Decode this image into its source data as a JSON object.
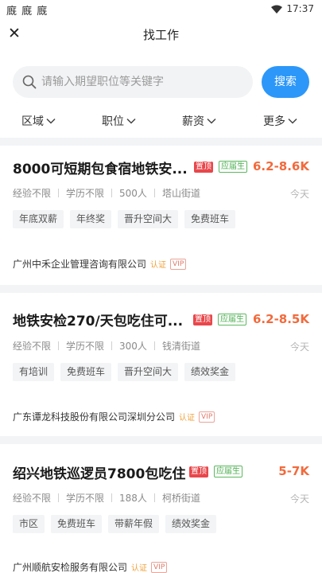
{
  "status_bar": {
    "left_icons": "廐 廐 廐",
    "time": "17:37"
  },
  "header": {
    "close_glyph": "✕",
    "title": "找工作"
  },
  "search": {
    "placeholder": "请输入期望职位等关键字",
    "button_label": "搜索"
  },
  "filters": [
    {
      "label": "区域"
    },
    {
      "label": "职位"
    },
    {
      "label": "薪资"
    },
    {
      "label": "更多"
    }
  ],
  "jobs": [
    {
      "title": "8000可短期包食宿地铁安...",
      "badge_top": "置顶",
      "badge_grad": "应届生",
      "salary": "6.2-8.6K",
      "meta": [
        "经验不限",
        "学历不限",
        "500人",
        "塔山街道"
      ],
      "date": "今天",
      "tags": [
        "年底双薪",
        "年终奖",
        "晋升空间大",
        "免费班车"
      ],
      "company": "广州中禾企业管理咨询有限公司",
      "cert": "认证",
      "vip": "VIP"
    },
    {
      "title": "地铁安检270/天包吃住可...",
      "badge_top": "置顶",
      "badge_grad": "应届生",
      "salary": "6.2-8.5K",
      "meta": [
        "经验不限",
        "学历不限",
        "300人",
        "钱清街道"
      ],
      "date": "今天",
      "tags": [
        "有培训",
        "免费班车",
        "晋升空间大",
        "绩效奖金"
      ],
      "company": "广东谭龙科技股份有限公司深圳分公司",
      "cert": "认证",
      "vip": "VIP"
    },
    {
      "title": "绍兴地铁巡逻员7800包吃住",
      "badge_top": "置顶",
      "badge_grad": "应届生",
      "salary": "5-7K",
      "meta": [
        "经验不限",
        "学历不限",
        "188人",
        "柯桥街道"
      ],
      "date": "今天",
      "tags": [
        "市区",
        "免费班车",
        "带薪年假",
        "绩效奖金"
      ],
      "company": "广州顺航安检服务有限公司",
      "cert": "认证",
      "vip": "VIP"
    }
  ],
  "colors": {
    "accent": "#2c97f8",
    "salary": "#f26a3c",
    "badge_top": "#e8474b",
    "badge_grad": "#4caf50"
  },
  "icons": [
    "wifi-icon",
    "battery-icon",
    "close-icon",
    "search-icon",
    "chevron-down-icon"
  ]
}
